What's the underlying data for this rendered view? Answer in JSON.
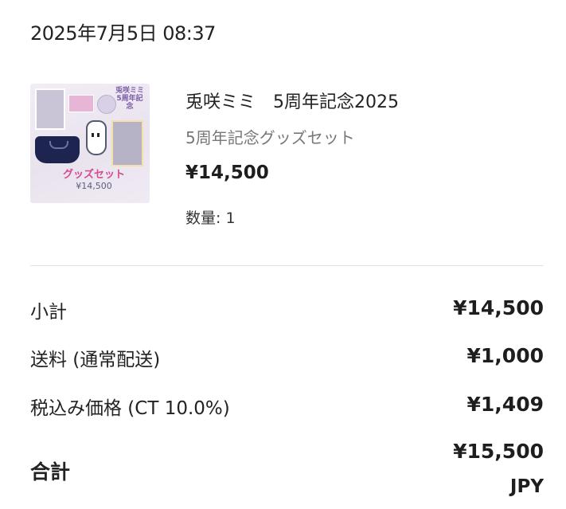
{
  "order": {
    "date": "2025年7月5日 08:37"
  },
  "product": {
    "name": "兎咲ミミ　5周年記念2025",
    "variant": "5周年記念グッズセット",
    "price": "¥14,500",
    "quantity": "数量: 1",
    "image": {
      "label": "グッズセット",
      "price_text": "¥14,500",
      "title_art": "兎咲ミミ 5周年記念"
    }
  },
  "summary": {
    "subtotal_label": "小計",
    "subtotal_value": "¥14,500",
    "shipping_label": "送料 (通常配送)",
    "shipping_value": "¥1,000",
    "tax_label": "税込み価格 (CT 10.0%)",
    "tax_value": "¥1,409",
    "total_label": "合計",
    "total_value": "¥15,500",
    "total_currency": "JPY"
  }
}
